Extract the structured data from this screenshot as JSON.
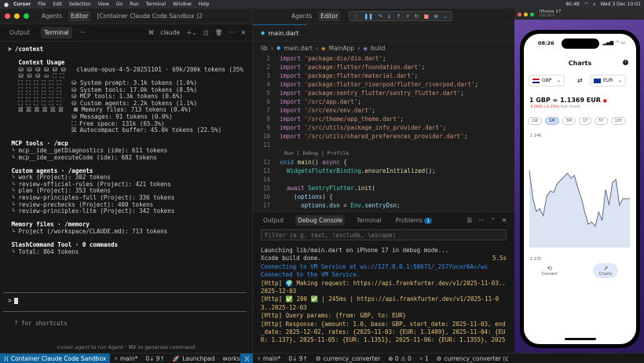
{
  "menubar": {
    "app": "Cursor",
    "items": [
      "File",
      "Edit",
      "Selection",
      "View",
      "Go",
      "Run",
      "Terminal",
      "Window",
      "Help"
    ],
    "battery": "80.4B",
    "datetime": "Wed 3 Dec  10:01"
  },
  "left": {
    "title_tabs": [
      "Agents",
      "Editor",
      "[Container Claude Code Sandbox (2"
    ],
    "tabs": [
      "Output",
      "Terminal"
    ],
    "terminal_name": "claude",
    "term_lines": [
      {
        "t": "> /context",
        "c": "b"
      },
      {
        "t": "",
        "c": ""
      },
      {
        "t": "   Context Usage",
        "c": "b"
      },
      {
        "t": "   ⛁ ⛁ ⛁ ⛁ ⛁ ⛁   claude-opus-4-5-20251101 · 69k/200k tokens (35%)",
        "c": ""
      },
      {
        "t": "   ⛁ ⛁ ⛁ ⛀ ⛶ ⛶",
        "c": ""
      },
      {
        "t": "   ⛶ ⛶ ⛶ ⛶ ⛶ ⛶   ⛁ System prompt: 3.1k tokens (1.6%)",
        "c": ""
      },
      {
        "t": "   ⛶ ⛶ ⛶ ⛶ ⛶ ⛶   ⛁ System tools: 17.0k tokens (8.5%)",
        "c": ""
      },
      {
        "t": "   ⛶ ⛶ ⛶ ⛶ ⛶ ⛶   ⛁ MCP tools: 1.3k tokens (0.6%)",
        "c": ""
      },
      {
        "t": "   ⛶ ⛶ ⛶ ⛶ ⛶ ⛶   ⛁ Custom agents: 2.2k tokens (1.1%)",
        "c": ""
      },
      {
        "t": "   ⛝ ⛝ ⛝ ⛝ ⛝ ⛝   ⛁ Memory files: 713 tokens (0.4%)",
        "c": ""
      },
      {
        "t": "                  ⛁ Messages: 91 tokens (0.0%)",
        "c": ""
      },
      {
        "t": "                  ⛶ Free space: 131k (65.3%)",
        "c": ""
      },
      {
        "t": "                  ⛝ Autocompact buffer: 45.0k tokens (22.5%)",
        "c": ""
      },
      {
        "t": "",
        "c": ""
      },
      {
        "t": " MCP tools · /mcp",
        "c": "b"
      },
      {
        "t": " └ mcp__ide__getDiagnostics (ide): 611 tokens",
        "c": ""
      },
      {
        "t": " └ mcp__ide__executeCode (ide): 682 tokens",
        "c": ""
      },
      {
        "t": "",
        "c": ""
      },
      {
        "t": " Custom agents · /agents",
        "c": "b"
      },
      {
        "t": " └ work (Project): 302 tokens",
        "c": ""
      },
      {
        "t": " └ review-official-rules (Project): 421 tokens",
        "c": ""
      },
      {
        "t": " └ plan (Project): 353 tokens",
        "c": ""
      },
      {
        "t": " └ review-principles-full (Project): 336 tokens",
        "c": ""
      },
      {
        "t": " └ review-prechecks (Project): 400 tokens",
        "c": ""
      },
      {
        "t": " └ review-principles-lite (Project): 342 tokens",
        "c": ""
      },
      {
        "t": "",
        "c": ""
      },
      {
        "t": " Memory files · /memory",
        "c": "b"
      },
      {
        "t": " └ Project (/workspace/CLAUDE.md): 713 tokens",
        "c": ""
      },
      {
        "t": "",
        "c": ""
      },
      {
        "t": " SlashCommand Tool · 0 commands",
        "c": "b"
      },
      {
        "t": " └ Total: 864 tokens",
        "c": ""
      }
    ],
    "prompt": ">",
    "shortcuts": "? for shortcuts",
    "hint": "cursor  agent to run Agent · ⌘K to generate command"
  },
  "status": {
    "remote": "Container Claude Code Sandbox",
    "branch": "main*",
    "sync": "0↓ 9↑",
    "launchpad": "Launchpad",
    "workspace": "workspa",
    "remote2": "",
    "branch2": "main*",
    "sync2": "0↓ 9↑",
    "debug_name": "currency_converter",
    "problems": "⊗ 0 ⚠ 0",
    "ports": "⑂ 1",
    "debug_name2": "currency_converter (c"
  },
  "editor": {
    "title_tabs": [
      "Agents",
      "Editor"
    ],
    "file_tab": "main.dart",
    "breadcrumb": [
      "lib",
      "main.dart",
      "MainApp",
      "build"
    ],
    "codelens": "Run | Debug | Profile",
    "code": [
      {
        "n": "1",
        "parts": [
          [
            "kw",
            "import "
          ],
          [
            "str",
            "'package:dio/dio.dart'"
          ],
          [
            "pl",
            ";"
          ]
        ]
      },
      {
        "n": "2",
        "parts": [
          [
            "kw",
            "import "
          ],
          [
            "str",
            "'package:flutter/foundation.dart'"
          ],
          [
            "pl",
            ";"
          ]
        ]
      },
      {
        "n": "3",
        "parts": [
          [
            "kw",
            "import "
          ],
          [
            "str",
            "'package:flutter/material.dart'"
          ],
          [
            "pl",
            ";"
          ]
        ]
      },
      {
        "n": "4",
        "parts": [
          [
            "kw",
            "import "
          ],
          [
            "str",
            "'package:flutter_riverpod/flutter_riverpod.dart'"
          ],
          [
            "pl",
            ";"
          ]
        ]
      },
      {
        "n": "5",
        "parts": [
          [
            "kw",
            "import "
          ],
          [
            "str",
            "'package:sentry_flutter/sentry_flutter.dart'"
          ],
          [
            "pl",
            ";"
          ]
        ]
      },
      {
        "n": "6",
        "parts": [
          [
            "kw",
            "import "
          ],
          [
            "str",
            "'/src/app.dart'"
          ],
          [
            "pl",
            ";"
          ]
        ]
      },
      {
        "n": "7",
        "parts": [
          [
            "kw",
            "import "
          ],
          [
            "str",
            "'/src/env/env.dart'"
          ],
          [
            "pl",
            ";"
          ]
        ]
      },
      {
        "n": "8",
        "parts": [
          [
            "kw",
            "import "
          ],
          [
            "str",
            "'/src/theme/app_theme.dart'"
          ],
          [
            "pl",
            ";"
          ]
        ]
      },
      {
        "n": "9",
        "parts": [
          [
            "kw",
            "import "
          ],
          [
            "str",
            "'/src/utils/package_info_provider.dart'"
          ],
          [
            "pl",
            ";"
          ]
        ]
      },
      {
        "n": "10",
        "parts": [
          [
            "kw",
            "import "
          ],
          [
            "str",
            "'/src/utils/shared_preferences_provider.dart'"
          ],
          [
            "pl",
            ";"
          ]
        ]
      },
      {
        "n": "11",
        "parts": [
          [
            "pl",
            ""
          ]
        ]
      },
      {
        "n": "12",
        "lens": true,
        "parts": [
          [
            "kw2",
            "void "
          ],
          [
            "fn",
            "main"
          ],
          [
            "pl",
            "() "
          ],
          [
            "kw",
            "async"
          ],
          [
            "pl",
            " {"
          ]
        ]
      },
      {
        "n": "13",
        "parts": [
          [
            "pl",
            "  "
          ],
          [
            "ty",
            "WidgetsFlutterBinding"
          ],
          [
            "pl",
            "."
          ],
          [
            "fn",
            "ensureInitialized"
          ],
          [
            "pl",
            "();"
          ]
        ]
      },
      {
        "n": "14",
        "parts": [
          [
            "pl",
            ""
          ]
        ]
      },
      {
        "n": "15",
        "parts": [
          [
            "pl",
            "  "
          ],
          [
            "kw",
            "await "
          ],
          [
            "ty",
            "SentryFlutter"
          ],
          [
            "pl",
            "."
          ],
          [
            "fn",
            "init"
          ],
          [
            "pl",
            "("
          ]
        ]
      },
      {
        "n": "16",
        "parts": [
          [
            "pl",
            "    ("
          ],
          [
            "var",
            "options"
          ],
          [
            "pl",
            ") {"
          ]
        ]
      },
      {
        "n": "17",
        "parts": [
          [
            "pl",
            "      "
          ],
          [
            "var",
            "options"
          ],
          [
            "pl",
            "."
          ],
          [
            "var",
            "dsn"
          ],
          [
            "pl",
            " = "
          ],
          [
            "ty",
            "Env"
          ],
          [
            "pl",
            "."
          ],
          [
            "var",
            "sentryDsn"
          ],
          [
            "pl",
            ";"
          ]
        ]
      }
    ]
  },
  "panel": {
    "tabs": [
      "Output",
      "Debug Console",
      "Terminal",
      "Problems"
    ],
    "problems_count": "1",
    "filter_placeholder": "Filter (e.g. text, !exclude, \\escape)",
    "console": [
      {
        "t": "Launching lib/main.dart on iPhone 17 in debug mode...",
        "c": "c-def"
      },
      {
        "t": "Xcode build done.",
        "c": "c-def",
        "r": "5.5s"
      },
      {
        "t": "Connecting to VM Service at ws://127.0.0.1:58671/_2S7Yocor6A=/ws",
        "c": "c-blue"
      },
      {
        "t": "Connected to the VM Service.",
        "c": "c-blue"
      },
      {
        "t": "[Http] 🌍 Making request: https://api.frankfurter.dev/v1/2025-11-03..",
        "c": "c-yel"
      },
      {
        "t": "2025-12-03",
        "c": "c-yel"
      },
      {
        "t": "[Http] ✅ 200 ✅ | 245ms | https://api.frankfurter.dev/v1/2025-11-0",
        "c": "c-yel"
      },
      {
        "t": "3..2025-12-03",
        "c": "c-yel"
      },
      {
        "t": "[Http] Query params: {from: GBP, to: EUR}",
        "c": "c-yel"
      },
      {
        "t": "[Http] Response: {amount: 1.0, base: GBP, start_date: 2025-11-03, end",
        "c": "c-yel"
      },
      {
        "t": "_date: 2025-12-02, rates: {2025-11-03: {EUR: 1.1409}, 2025-11-04: {EU",
        "c": "c-yel"
      },
      {
        "t": "R: 1.137}, 2025-11-05: {EUR: 1.1351}, 2025-11-06: {EUR: 1.1355}, 2025",
        "c": "c-yel"
      }
    ]
  },
  "sim": {
    "device": "iPhone 17",
    "os": "iOS 26.1",
    "time": "08:26",
    "title": "Charts",
    "from": "GBP",
    "to": "EUR",
    "rate": "1 GBP = 1.1369 EUR",
    "change": "-0.0040 (-0.35%)",
    "change_period": "Past month",
    "ranges": [
      "1W",
      "1M",
      "3M",
      "1Y",
      "5Y",
      "10Y"
    ],
    "active_range": "1M",
    "tabs": [
      "Convert",
      "Charts"
    ]
  },
  "chart_data": {
    "type": "area",
    "title": "",
    "xlabel": "",
    "ylabel": "",
    "ylim": [
      1.13,
      1.146
    ],
    "y_ticks": [
      "1.146",
      "1.135"
    ],
    "series": [
      {
        "values": [
          1.1409,
          1.137,
          1.1351,
          1.1355,
          1.1345,
          1.1372,
          1.138,
          1.1378,
          1.139,
          1.1395,
          1.14,
          1.1405,
          1.1398,
          1.1402,
          1.1384,
          1.137,
          1.135,
          1.1333,
          1.1336,
          1.133,
          1.135,
          1.1338,
          1.1382,
          1.136,
          1.1392,
          1.1396,
          1.136,
          1.1369,
          1.1369,
          1.1369
        ]
      }
    ]
  }
}
